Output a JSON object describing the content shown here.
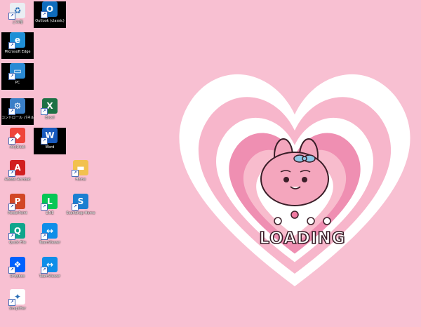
{
  "desktop": {
    "loading_text": "LOADING",
    "icons": [
      {
        "label": "ごみ箱",
        "icon": "recycle-bin-icon",
        "color": "#eaeef3"
      },
      {
        "label": "Outlook (classic)",
        "icon": "outlook-icon",
        "color": "#0f6cbd"
      },
      {
        "label": "Microsoft Edge",
        "icon": "edge-icon",
        "color": "#1f8fd6"
      },
      {
        "label": "PC",
        "icon": "pc-icon",
        "color": "#2a8ad4"
      },
      {
        "label": "コントロール パネル",
        "icon": "control-panel-icon",
        "color": "#3a7fc7"
      },
      {
        "label": "Excel",
        "icon": "excel-icon",
        "color": "#1d7044"
      },
      {
        "label": "AnyDesk",
        "icon": "anydesk-icon",
        "color": "#ef443b"
      },
      {
        "label": "Word",
        "icon": "word-icon",
        "color": "#185abd"
      },
      {
        "label": "Adobe Acrobat",
        "icon": "acrobat-icon",
        "color": "#d11f1f"
      },
      {
        "label": "Home",
        "icon": "folder-icon",
        "color": "#f2c14e"
      },
      {
        "label": "PowerPoint",
        "icon": "powerpoint-icon",
        "color": "#d24726"
      },
      {
        "label": "LINE",
        "icon": "line-icon",
        "color": "#06c755"
      },
      {
        "label": "ScanSnap Home",
        "icon": "scansnap-icon",
        "color": "#1c7fd1"
      },
      {
        "label": "Quick File",
        "icon": "quickfile-icon",
        "color": "#0fa58c"
      },
      {
        "label": "TeamViewer",
        "icon": "teamviewer-icon",
        "color": "#0e8ee9"
      },
      {
        "label": "Dropbox",
        "icon": "dropbox-icon",
        "color": "#0061fe"
      },
      {
        "label": "TeamViewer",
        "icon": "teamviewer-icon",
        "color": "#0e8ee9"
      },
      {
        "label": "Simplifier",
        "icon": "simplifier-icon",
        "color": "#ffffff"
      }
    ]
  }
}
